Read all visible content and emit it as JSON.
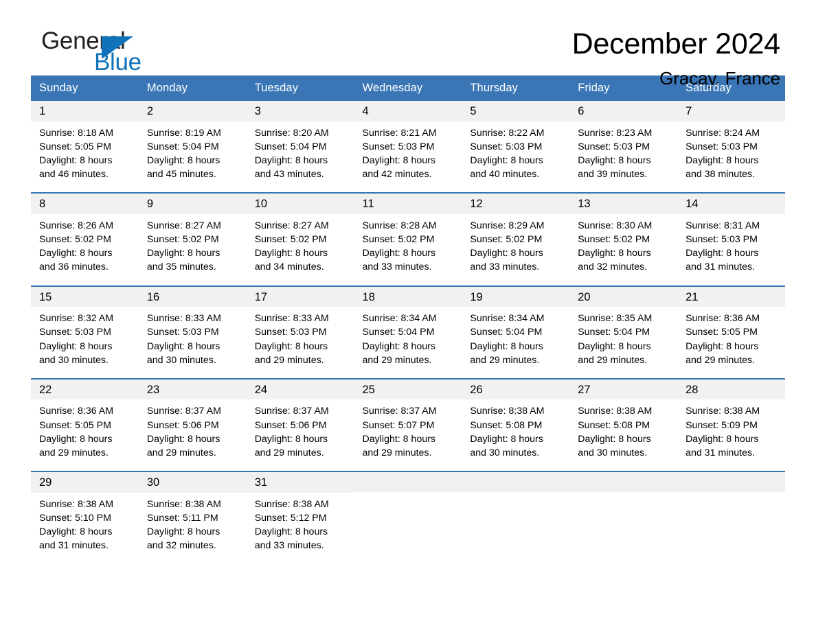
{
  "brand": {
    "name_part1": "General",
    "name_part2": "Blue",
    "accent_color": "#1072bb"
  },
  "header": {
    "title": "December 2024",
    "subtitle": "Gracay, France"
  },
  "theme": {
    "header_row_bg": "#3a75b6",
    "daynum_bg": "#f1f1f1",
    "row_divider": "#3a75b6"
  },
  "weekday_headers": [
    "Sunday",
    "Monday",
    "Tuesday",
    "Wednesday",
    "Thursday",
    "Friday",
    "Saturday"
  ],
  "weeks": [
    [
      {
        "day": "1",
        "sunrise": "Sunrise: 8:18 AM",
        "sunset": "Sunset: 5:05 PM",
        "daylight_line1": "Daylight: 8 hours",
        "daylight_line2": "and 46 minutes."
      },
      {
        "day": "2",
        "sunrise": "Sunrise: 8:19 AM",
        "sunset": "Sunset: 5:04 PM",
        "daylight_line1": "Daylight: 8 hours",
        "daylight_line2": "and 45 minutes."
      },
      {
        "day": "3",
        "sunrise": "Sunrise: 8:20 AM",
        "sunset": "Sunset: 5:04 PM",
        "daylight_line1": "Daylight: 8 hours",
        "daylight_line2": "and 43 minutes."
      },
      {
        "day": "4",
        "sunrise": "Sunrise: 8:21 AM",
        "sunset": "Sunset: 5:03 PM",
        "daylight_line1": "Daylight: 8 hours",
        "daylight_line2": "and 42 minutes."
      },
      {
        "day": "5",
        "sunrise": "Sunrise: 8:22 AM",
        "sunset": "Sunset: 5:03 PM",
        "daylight_line1": "Daylight: 8 hours",
        "daylight_line2": "and 40 minutes."
      },
      {
        "day": "6",
        "sunrise": "Sunrise: 8:23 AM",
        "sunset": "Sunset: 5:03 PM",
        "daylight_line1": "Daylight: 8 hours",
        "daylight_line2": "and 39 minutes."
      },
      {
        "day": "7",
        "sunrise": "Sunrise: 8:24 AM",
        "sunset": "Sunset: 5:03 PM",
        "daylight_line1": "Daylight: 8 hours",
        "daylight_line2": "and 38 minutes."
      }
    ],
    [
      {
        "day": "8",
        "sunrise": "Sunrise: 8:26 AM",
        "sunset": "Sunset: 5:02 PM",
        "daylight_line1": "Daylight: 8 hours",
        "daylight_line2": "and 36 minutes."
      },
      {
        "day": "9",
        "sunrise": "Sunrise: 8:27 AM",
        "sunset": "Sunset: 5:02 PM",
        "daylight_line1": "Daylight: 8 hours",
        "daylight_line2": "and 35 minutes."
      },
      {
        "day": "10",
        "sunrise": "Sunrise: 8:27 AM",
        "sunset": "Sunset: 5:02 PM",
        "daylight_line1": "Daylight: 8 hours",
        "daylight_line2": "and 34 minutes."
      },
      {
        "day": "11",
        "sunrise": "Sunrise: 8:28 AM",
        "sunset": "Sunset: 5:02 PM",
        "daylight_line1": "Daylight: 8 hours",
        "daylight_line2": "and 33 minutes."
      },
      {
        "day": "12",
        "sunrise": "Sunrise: 8:29 AM",
        "sunset": "Sunset: 5:02 PM",
        "daylight_line1": "Daylight: 8 hours",
        "daylight_line2": "and 33 minutes."
      },
      {
        "day": "13",
        "sunrise": "Sunrise: 8:30 AM",
        "sunset": "Sunset: 5:02 PM",
        "daylight_line1": "Daylight: 8 hours",
        "daylight_line2": "and 32 minutes."
      },
      {
        "day": "14",
        "sunrise": "Sunrise: 8:31 AM",
        "sunset": "Sunset: 5:03 PM",
        "daylight_line1": "Daylight: 8 hours",
        "daylight_line2": "and 31 minutes."
      }
    ],
    [
      {
        "day": "15",
        "sunrise": "Sunrise: 8:32 AM",
        "sunset": "Sunset: 5:03 PM",
        "daylight_line1": "Daylight: 8 hours",
        "daylight_line2": "and 30 minutes."
      },
      {
        "day": "16",
        "sunrise": "Sunrise: 8:33 AM",
        "sunset": "Sunset: 5:03 PM",
        "daylight_line1": "Daylight: 8 hours",
        "daylight_line2": "and 30 minutes."
      },
      {
        "day": "17",
        "sunrise": "Sunrise: 8:33 AM",
        "sunset": "Sunset: 5:03 PM",
        "daylight_line1": "Daylight: 8 hours",
        "daylight_line2": "and 29 minutes."
      },
      {
        "day": "18",
        "sunrise": "Sunrise: 8:34 AM",
        "sunset": "Sunset: 5:04 PM",
        "daylight_line1": "Daylight: 8 hours",
        "daylight_line2": "and 29 minutes."
      },
      {
        "day": "19",
        "sunrise": "Sunrise: 8:34 AM",
        "sunset": "Sunset: 5:04 PM",
        "daylight_line1": "Daylight: 8 hours",
        "daylight_line2": "and 29 minutes."
      },
      {
        "day": "20",
        "sunrise": "Sunrise: 8:35 AM",
        "sunset": "Sunset: 5:04 PM",
        "daylight_line1": "Daylight: 8 hours",
        "daylight_line2": "and 29 minutes."
      },
      {
        "day": "21",
        "sunrise": "Sunrise: 8:36 AM",
        "sunset": "Sunset: 5:05 PM",
        "daylight_line1": "Daylight: 8 hours",
        "daylight_line2": "and 29 minutes."
      }
    ],
    [
      {
        "day": "22",
        "sunrise": "Sunrise: 8:36 AM",
        "sunset": "Sunset: 5:05 PM",
        "daylight_line1": "Daylight: 8 hours",
        "daylight_line2": "and 29 minutes."
      },
      {
        "day": "23",
        "sunrise": "Sunrise: 8:37 AM",
        "sunset": "Sunset: 5:06 PM",
        "daylight_line1": "Daylight: 8 hours",
        "daylight_line2": "and 29 minutes."
      },
      {
        "day": "24",
        "sunrise": "Sunrise: 8:37 AM",
        "sunset": "Sunset: 5:06 PM",
        "daylight_line1": "Daylight: 8 hours",
        "daylight_line2": "and 29 minutes."
      },
      {
        "day": "25",
        "sunrise": "Sunrise: 8:37 AM",
        "sunset": "Sunset: 5:07 PM",
        "daylight_line1": "Daylight: 8 hours",
        "daylight_line2": "and 29 minutes."
      },
      {
        "day": "26",
        "sunrise": "Sunrise: 8:38 AM",
        "sunset": "Sunset: 5:08 PM",
        "daylight_line1": "Daylight: 8 hours",
        "daylight_line2": "and 30 minutes."
      },
      {
        "day": "27",
        "sunrise": "Sunrise: 8:38 AM",
        "sunset": "Sunset: 5:08 PM",
        "daylight_line1": "Daylight: 8 hours",
        "daylight_line2": "and 30 minutes."
      },
      {
        "day": "28",
        "sunrise": "Sunrise: 8:38 AM",
        "sunset": "Sunset: 5:09 PM",
        "daylight_line1": "Daylight: 8 hours",
        "daylight_line2": "and 31 minutes."
      }
    ],
    [
      {
        "day": "29",
        "sunrise": "Sunrise: 8:38 AM",
        "sunset": "Sunset: 5:10 PM",
        "daylight_line1": "Daylight: 8 hours",
        "daylight_line2": "and 31 minutes."
      },
      {
        "day": "30",
        "sunrise": "Sunrise: 8:38 AM",
        "sunset": "Sunset: 5:11 PM",
        "daylight_line1": "Daylight: 8 hours",
        "daylight_line2": "and 32 minutes."
      },
      {
        "day": "31",
        "sunrise": "Sunrise: 8:38 AM",
        "sunset": "Sunset: 5:12 PM",
        "daylight_line1": "Daylight: 8 hours",
        "daylight_line2": "and 33 minutes."
      },
      {
        "day": "",
        "sunrise": "",
        "sunset": "",
        "daylight_line1": "",
        "daylight_line2": ""
      },
      {
        "day": "",
        "sunrise": "",
        "sunset": "",
        "daylight_line1": "",
        "daylight_line2": ""
      },
      {
        "day": "",
        "sunrise": "",
        "sunset": "",
        "daylight_line1": "",
        "daylight_line2": ""
      },
      {
        "day": "",
        "sunrise": "",
        "sunset": "",
        "daylight_line1": "",
        "daylight_line2": ""
      }
    ]
  ]
}
